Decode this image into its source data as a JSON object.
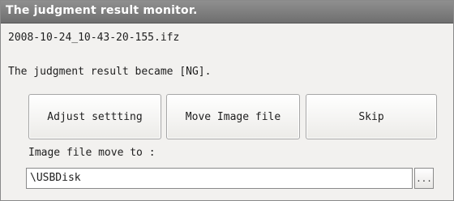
{
  "window": {
    "title": "The judgment result monitor."
  },
  "content": {
    "filename": "2008-10-24_10-43-20-155.ifz",
    "message": "The judgment result became [NG]."
  },
  "buttons": {
    "adjust_label": "Adjust settting",
    "move_label": "Move Image file",
    "skip_label": "Skip"
  },
  "destination": {
    "label": "Image file move to :",
    "path_value": "\\USBDisk",
    "browse_label": "..."
  }
}
